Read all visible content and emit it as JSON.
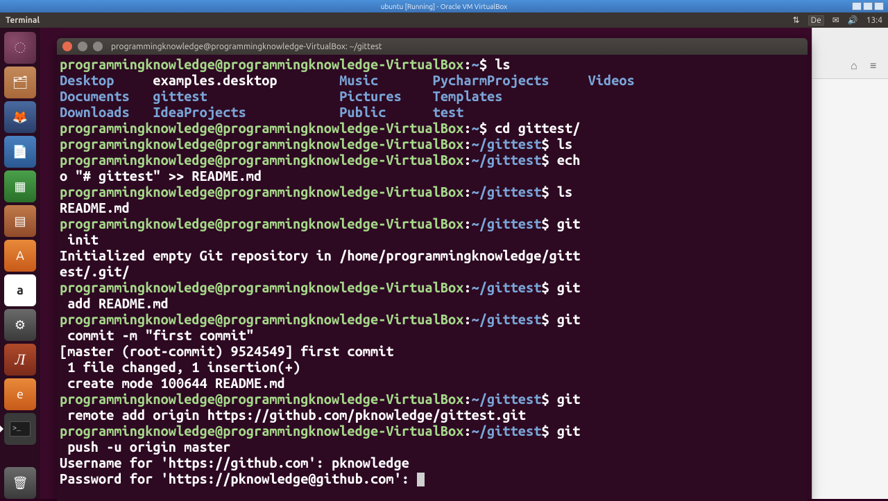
{
  "vbox": {
    "title": "ubuntu [Running] - Oracle VM VirtualBox"
  },
  "panel": {
    "app": "Terminal",
    "lang": "De",
    "time": "13:4"
  },
  "launcher": {
    "items": [
      {
        "name": "dash",
        "glyph": "◌"
      },
      {
        "name": "files",
        "glyph": "🗂"
      },
      {
        "name": "firefox",
        "glyph": "🦊"
      },
      {
        "name": "writer",
        "glyph": "📄"
      },
      {
        "name": "calc",
        "glyph": "▦"
      },
      {
        "name": "impress",
        "glyph": "▤"
      },
      {
        "name": "software",
        "glyph": "A"
      },
      {
        "name": "amazon",
        "glyph": "a"
      },
      {
        "name": "settings",
        "glyph": "⚙"
      },
      {
        "name": "jt",
        "glyph": "Л"
      },
      {
        "name": "orange",
        "glyph": "e"
      },
      {
        "name": "terminal",
        "glyph": ">_"
      }
    ],
    "trash_glyph": "🗑"
  },
  "terminal": {
    "title": "programmingknowledge@programmingknowledge-VirtualBox: ~/gittest",
    "prompt_user": "programmingknowledge@programmingknowledge-VirtualBox",
    "path_home": "~",
    "path_gittest": "~/gittest",
    "ls_dirs_row1": [
      "Desktop",
      "examples.desktop",
      "Music",
      "PycharmProjects",
      "Videos"
    ],
    "ls_dirs_row2": [
      "Documents",
      "gittest",
      "Pictures",
      "Templates"
    ],
    "ls_dirs_row3": [
      "Downloads",
      "IdeaProjects",
      "Public",
      "test"
    ],
    "cmds": {
      "ls": "ls",
      "cd": "cd gittest/",
      "echo": "echo \"# gittest\" >> README.md",
      "ls2_out": "README.md",
      "git_init": "git init",
      "git_init_out": "Initialized empty Git repository in /home/programmingknowledge/gittest/.git/",
      "git_add": "git add README.md",
      "git_commit": "git commit -m \"first commit\"",
      "commit_out1": "[master (root-commit) 9524549] first commit",
      "commit_out2": " 1 file changed, 1 insertion(+)",
      "commit_out3": " create mode 100644 README.md",
      "git_remote": "git remote add origin https://github.com/pknowledge/gittest.git",
      "git_push": "git push -u origin master",
      "username_prompt": "Username for 'https://github.com': ",
      "username_value": "pknowledge",
      "password_prompt": "Password for 'https://pknowledge@github.com': "
    }
  }
}
